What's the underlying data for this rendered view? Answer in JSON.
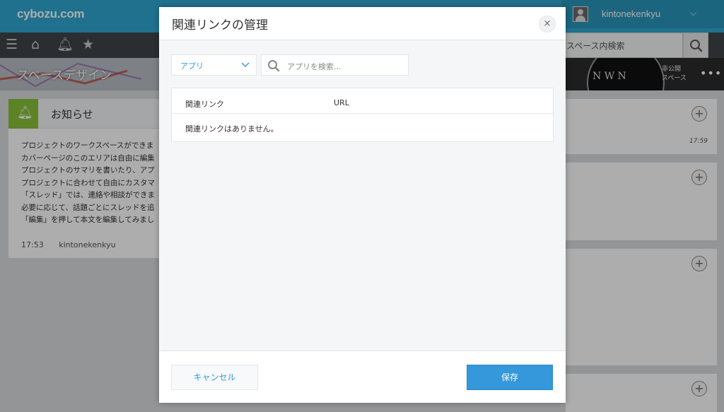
{
  "app": {
    "logo": "cybozu.com",
    "user_name": "kintonekenkyu",
    "search_placeholder": "スペース内検索",
    "cover_title": "スペースデザイン",
    "cover_private": "非公開\nスペース",
    "compass_text": "N W N",
    "nav_icons": [
      "menu-icon",
      "home-icon",
      "bell-icon",
      "star-icon"
    ]
  },
  "notice": {
    "title": "お知らせ",
    "lines": [
      "プロジェクトのワークスペースができま",
      "カバーページのこのエリアは自由に編集",
      "プロジェクトのサマリを書いたり、アプ",
      "プロジェクトに合わせて自由にカスタマ",
      "「スレッド」では、連絡や相談ができま",
      "必要に応じて、話題ごとにスレッドを追",
      "「編集」を押して本文を編集してみまし"
    ],
    "time": "17:53",
    "author": "kintonekenkyu"
  },
  "side": {
    "time": "17:59"
  },
  "modal": {
    "title": "関連リンクの管理",
    "close_label": "×",
    "app_select_label": "アプリ",
    "search_placeholder": "アプリを検索...",
    "table": {
      "col_link": "関連リンク",
      "col_url": "URL",
      "empty_message": "関連リンクはありません。"
    },
    "cancel_label": "キャンセル",
    "save_label": "保存"
  },
  "colors": {
    "accent": "#3498db",
    "topbar": "#2fa7d0",
    "navbar": "#3e4449",
    "notice_icon": "#89c23a"
  }
}
